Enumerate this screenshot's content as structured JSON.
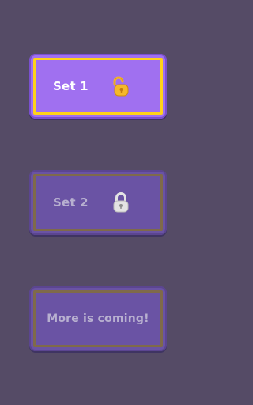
{
  "sets": [
    {
      "label": "Set 1",
      "status": "unlocked",
      "icon": "unlocked-padlock-icon"
    },
    {
      "label": "Set 2",
      "status": "locked",
      "icon": "locked-padlock-icon"
    },
    {
      "label": "More is coming!",
      "status": "coming-soon"
    }
  ],
  "colors": {
    "background": "#554b66",
    "active_card": "#a070f0",
    "inactive_card": "#6a53a4",
    "active_border": "#ffd21a",
    "inactive_border": "#7f6a4a",
    "unlocked_icon": "#f5b82a",
    "locked_icon": "#e4e4e4"
  }
}
